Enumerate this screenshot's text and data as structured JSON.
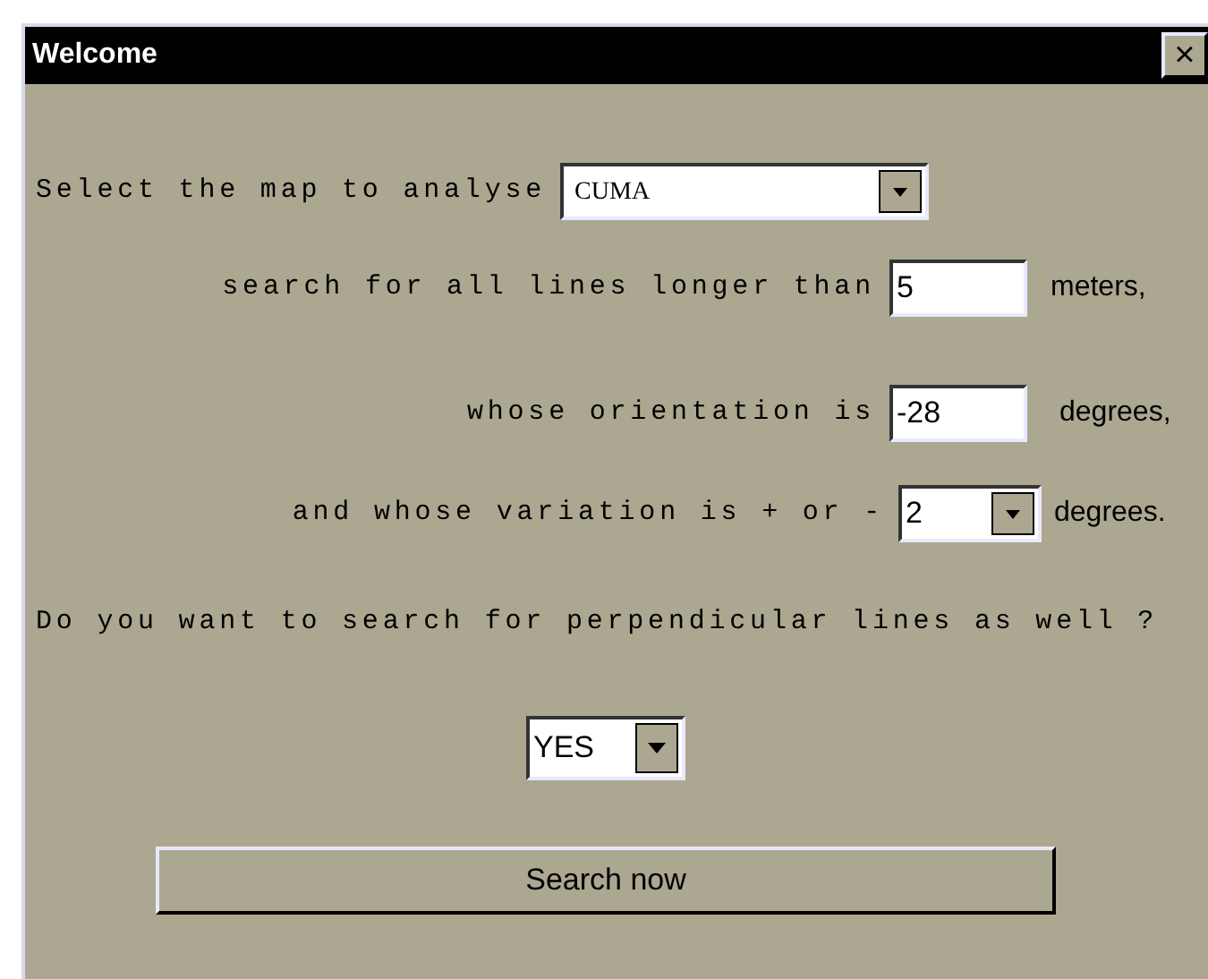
{
  "window": {
    "title": "Welcome",
    "close": "×"
  },
  "rows": [
    {
      "kind": "select",
      "label": "Select the map to analyse",
      "value": "CUMA"
    },
    {
      "kind": "input",
      "label": "search for all lines longer than",
      "value": "5",
      "unit": "meters,"
    },
    {
      "kind": "input",
      "label": "whose orientation is",
      "value": "-28",
      "unit": "degrees,"
    },
    {
      "kind": "select",
      "label": "and whose variation is + or -",
      "value": "2",
      "unit": "degrees."
    }
  ],
  "question": "Do you want to search for perpendicular lines as well ?",
  "perpendicular": {
    "value": "YES"
  },
  "button": "Search now"
}
